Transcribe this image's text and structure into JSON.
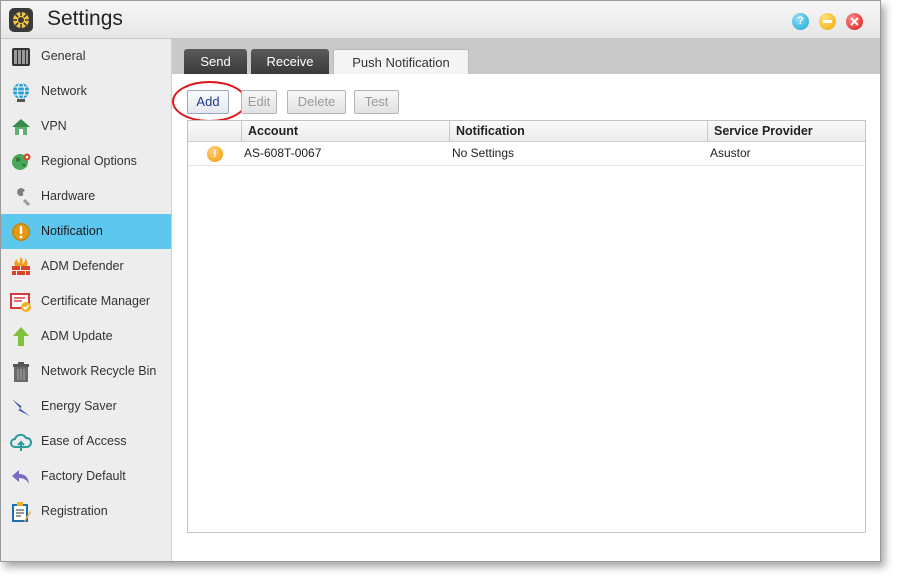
{
  "window": {
    "title": "Settings"
  },
  "titlebar": {
    "help_glyph": "?",
    "icons": [
      "help-icon",
      "minimize-icon",
      "close-icon"
    ]
  },
  "sidebar": {
    "active_color": "#5ec7ee",
    "items": [
      {
        "label": "General",
        "icon": "nas-device-icon"
      },
      {
        "label": "Network",
        "icon": "globe-icon"
      },
      {
        "label": "VPN",
        "icon": "vpn-house-icon"
      },
      {
        "label": "Regional Options",
        "icon": "regional-globe-icon"
      },
      {
        "label": "Hardware",
        "icon": "wrench-icon"
      },
      {
        "label": "Notification",
        "icon": "notification-alert-icon",
        "active": true
      },
      {
        "label": "ADM Defender",
        "icon": "firewall-icon"
      },
      {
        "label": "Certificate Manager",
        "icon": "certificate-icon"
      },
      {
        "label": "ADM Update",
        "icon": "update-arrow-icon"
      },
      {
        "label": "Network Recycle Bin",
        "icon": "trash-icon"
      },
      {
        "label": "Energy Saver",
        "icon": "lightning-icon"
      },
      {
        "label": "Ease of Access",
        "icon": "cloud-icon"
      },
      {
        "label": "Factory Default",
        "icon": "undo-icon"
      },
      {
        "label": "Registration",
        "icon": "clipboard-icon"
      }
    ]
  },
  "tabs": [
    {
      "label": "Send"
    },
    {
      "label": "Receive"
    },
    {
      "label": "Push Notification",
      "active": true
    }
  ],
  "toolbar": {
    "add_label": "Add",
    "edit_label": "Edit",
    "delete_label": "Delete",
    "test_label": "Test"
  },
  "table": {
    "columns": [
      "Account",
      "Notification",
      "Service Provider"
    ],
    "rows": [
      {
        "status_icon": "warning-icon",
        "status_glyph": "!",
        "account": "AS-608T-0067",
        "notification": "No Settings",
        "provider": "Asustor"
      }
    ]
  }
}
